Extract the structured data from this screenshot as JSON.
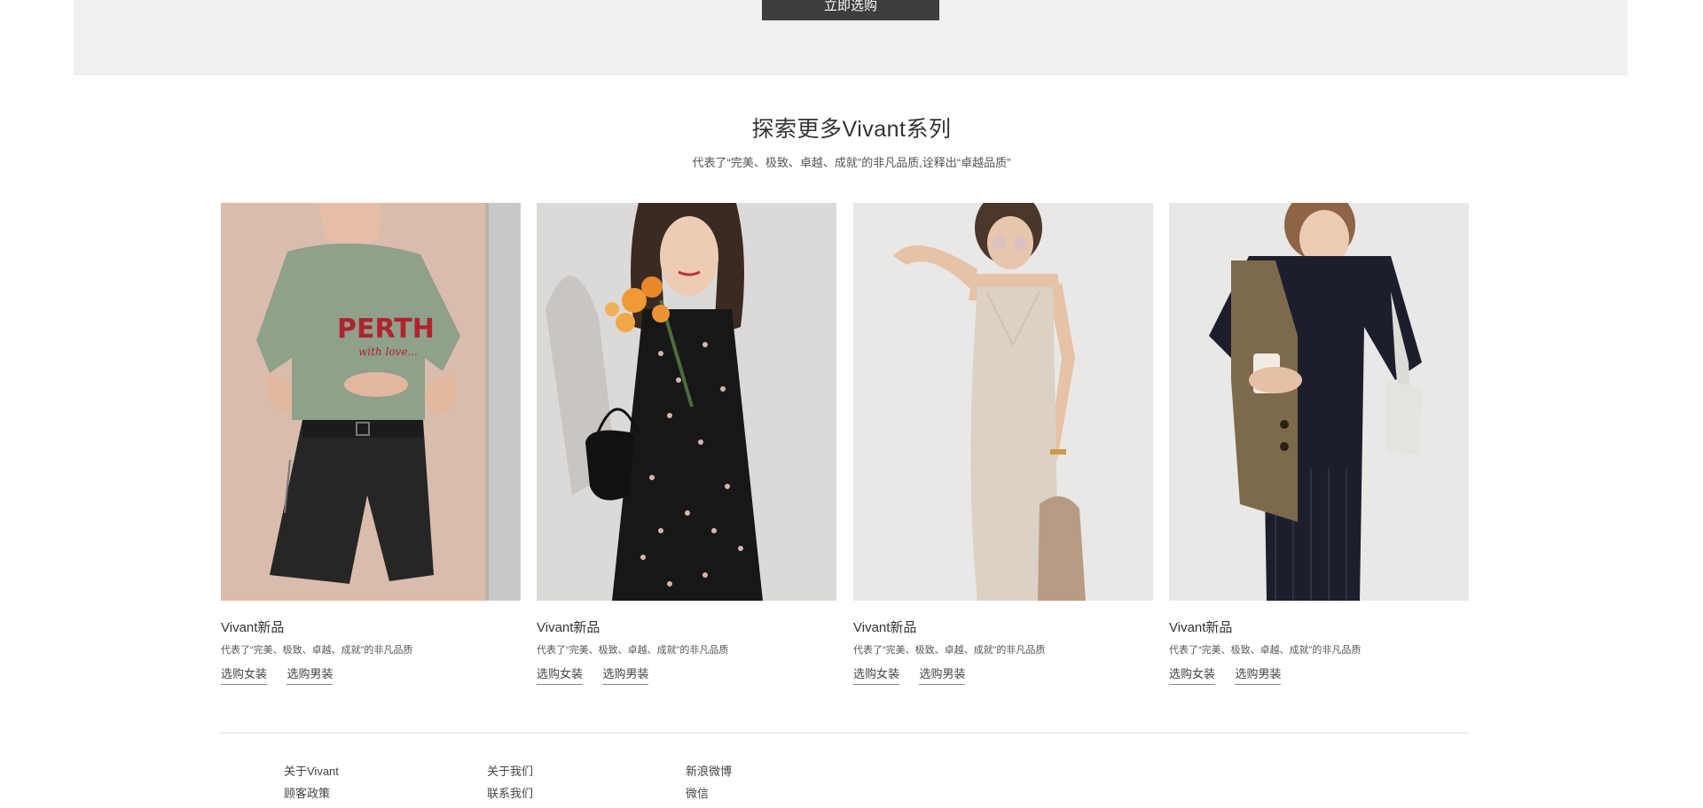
{
  "banner": {
    "shop_now_label": "立即选购",
    "background": "#f0f0f0",
    "button_color": "#3d3d3d"
  },
  "section": {
    "title": "探索更多Vivant系列",
    "subtitle": "代表了“完美、极致、卓越、成就”的非凡品质,诠释出“卓越品质”"
  },
  "products": [
    {
      "title": "Vivant新品",
      "desc": "代表了“完美、极致、卓越、成就”的非凡品质",
      "link_women": "选购女装",
      "link_men": "选购男装",
      "image": "woman-green-tshirt-leather-shorts"
    },
    {
      "title": "Vivant新品",
      "desc": "代表了“完美、极致、卓越、成就”的非凡品质",
      "link_women": "选购女装",
      "link_men": "选购男装",
      "image": "woman-floral-dress-flowers"
    },
    {
      "title": "Vivant新品",
      "desc": "代表了“完美、极致、卓越、成就”的非凡品质",
      "link_women": "选购女装",
      "link_men": "选购男装",
      "image": "woman-beige-slip-dress"
    },
    {
      "title": "Vivant新品",
      "desc": "代表了“完美、极致、卓越、成就”的非凡品质",
      "link_women": "选购女装",
      "link_men": "选购男装",
      "image": "woman-vest-black-dress"
    }
  ],
  "footer": {
    "columns": [
      {
        "items": [
          "关于Vivant",
          "顾客政策"
        ]
      },
      {
        "items": [
          "关于我们",
          "联系我们"
        ]
      },
      {
        "items": [
          "新浪微博",
          "微信"
        ]
      }
    ]
  }
}
